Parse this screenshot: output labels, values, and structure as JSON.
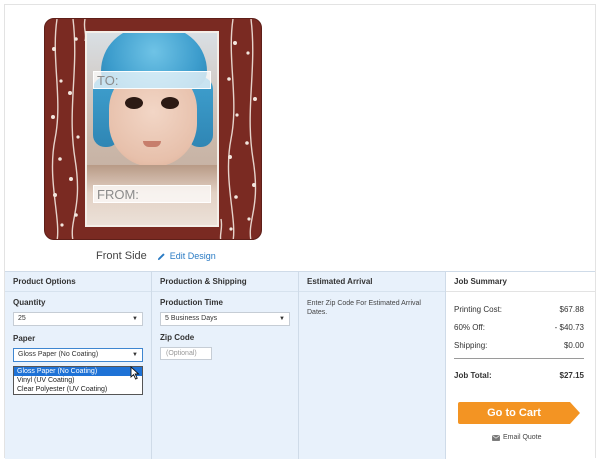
{
  "preview": {
    "to_label": "TO:",
    "from_label": "FROM:",
    "side_label": "Front Side",
    "edit_label": "Edit Design"
  },
  "columns": {
    "product_options": "Product Options",
    "production_shipping": "Production & Shipping",
    "estimated_arrival": "Estimated Arrival",
    "job_summary": "Job Summary"
  },
  "product": {
    "quantity_label": "Quantity",
    "quantity_value": "25",
    "paper_label": "Paper",
    "paper_value": "Gloss Paper (No Coating)",
    "paper_options": [
      "Gloss Paper (No Coating)",
      "Vinyl (UV Coating)",
      "Clear Polyester (UV Coating)"
    ]
  },
  "production": {
    "time_label": "Production Time",
    "time_value": "5 Business Days",
    "zip_label": "Zip Code",
    "zip_placeholder": "(Optional)"
  },
  "arrival": {
    "text": "Enter Zip Code For Estimated Arrival Dates."
  },
  "summary": {
    "printing_label": "Printing Cost:",
    "printing_value": "$67.88",
    "discount_label": "60% Off:",
    "discount_value": "- $40.73",
    "shipping_label": "Shipping:",
    "shipping_value": "$0.00",
    "total_label": "Job Total:",
    "total_value": "$27.15",
    "cart_label": "Go to Cart",
    "email_label": "Email Quote"
  },
  "colors": {
    "card": "#7a2a22",
    "accent_button": "#f39423",
    "link": "#2a7bc4",
    "selected": "#1e72d6",
    "panel": "#e8f1fb"
  }
}
